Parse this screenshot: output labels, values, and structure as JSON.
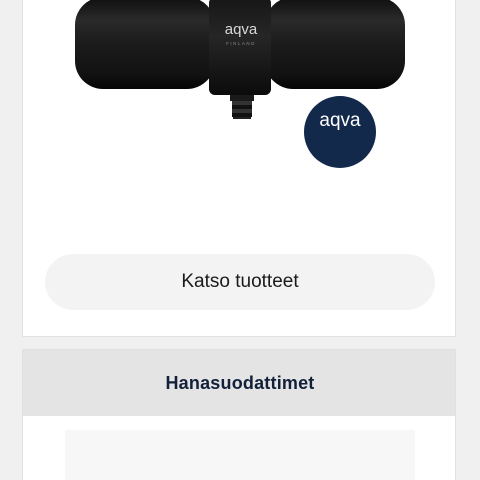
{
  "product_card": {
    "brand_logo": "aqva",
    "brand_sub": "FINLAND",
    "button_label": "Katso tuotteet"
  },
  "category_card": {
    "title": "Hanasuodattimet",
    "badge_logo": "aqva"
  },
  "colors": {
    "page_background": "#f0f0f0",
    "card_background": "#ffffff",
    "button_background": "#f3f3f3",
    "header_background": "#e4e4e4",
    "title_color": "#12203a",
    "badge_color": "#13294b",
    "product_color": "#1c1c1c"
  }
}
